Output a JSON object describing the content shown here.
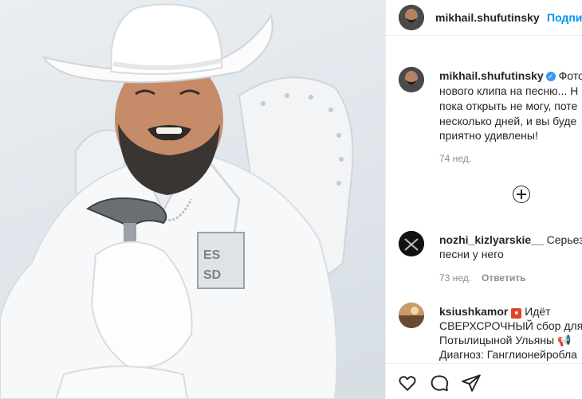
{
  "post": {
    "author": "mikhail.shufutinsky",
    "follow_label": "Подписаться",
    "caption_lines": [
      "Фото",
      "нового клипа на песню... Н",
      "пока открыть не могу, поте",
      "несколько дней, и вы буде",
      "приятно удивлены!"
    ],
    "time": "74 нед."
  },
  "comments": [
    {
      "username": "nozhi_kizlyarskie__",
      "text_lines": [
        "Серьезн",
        "песни у него"
      ],
      "time": "73 нед.",
      "reply_label": "Ответить"
    },
    {
      "username": "ksiushkamor",
      "text_lines": [
        "Идёт",
        "СВЕРХСРОЧНЫЙ сбор для",
        "Потылицыной Ульяны",
        "Диагноз: Ганглионейробла"
      ]
    }
  ],
  "icons": {
    "verified": "verified-badge-icon",
    "load_more": "plus-circle-icon",
    "like": "heart-icon",
    "comment": "comment-icon",
    "share": "paper-plane-icon",
    "flag": "red-square-emoji",
    "megaphone": "megaphone-emoji"
  },
  "colors": {
    "link_blue": "#0095f6",
    "verified_blue": "#3897f0",
    "muted": "#8e8e8e",
    "text": "#262626"
  }
}
